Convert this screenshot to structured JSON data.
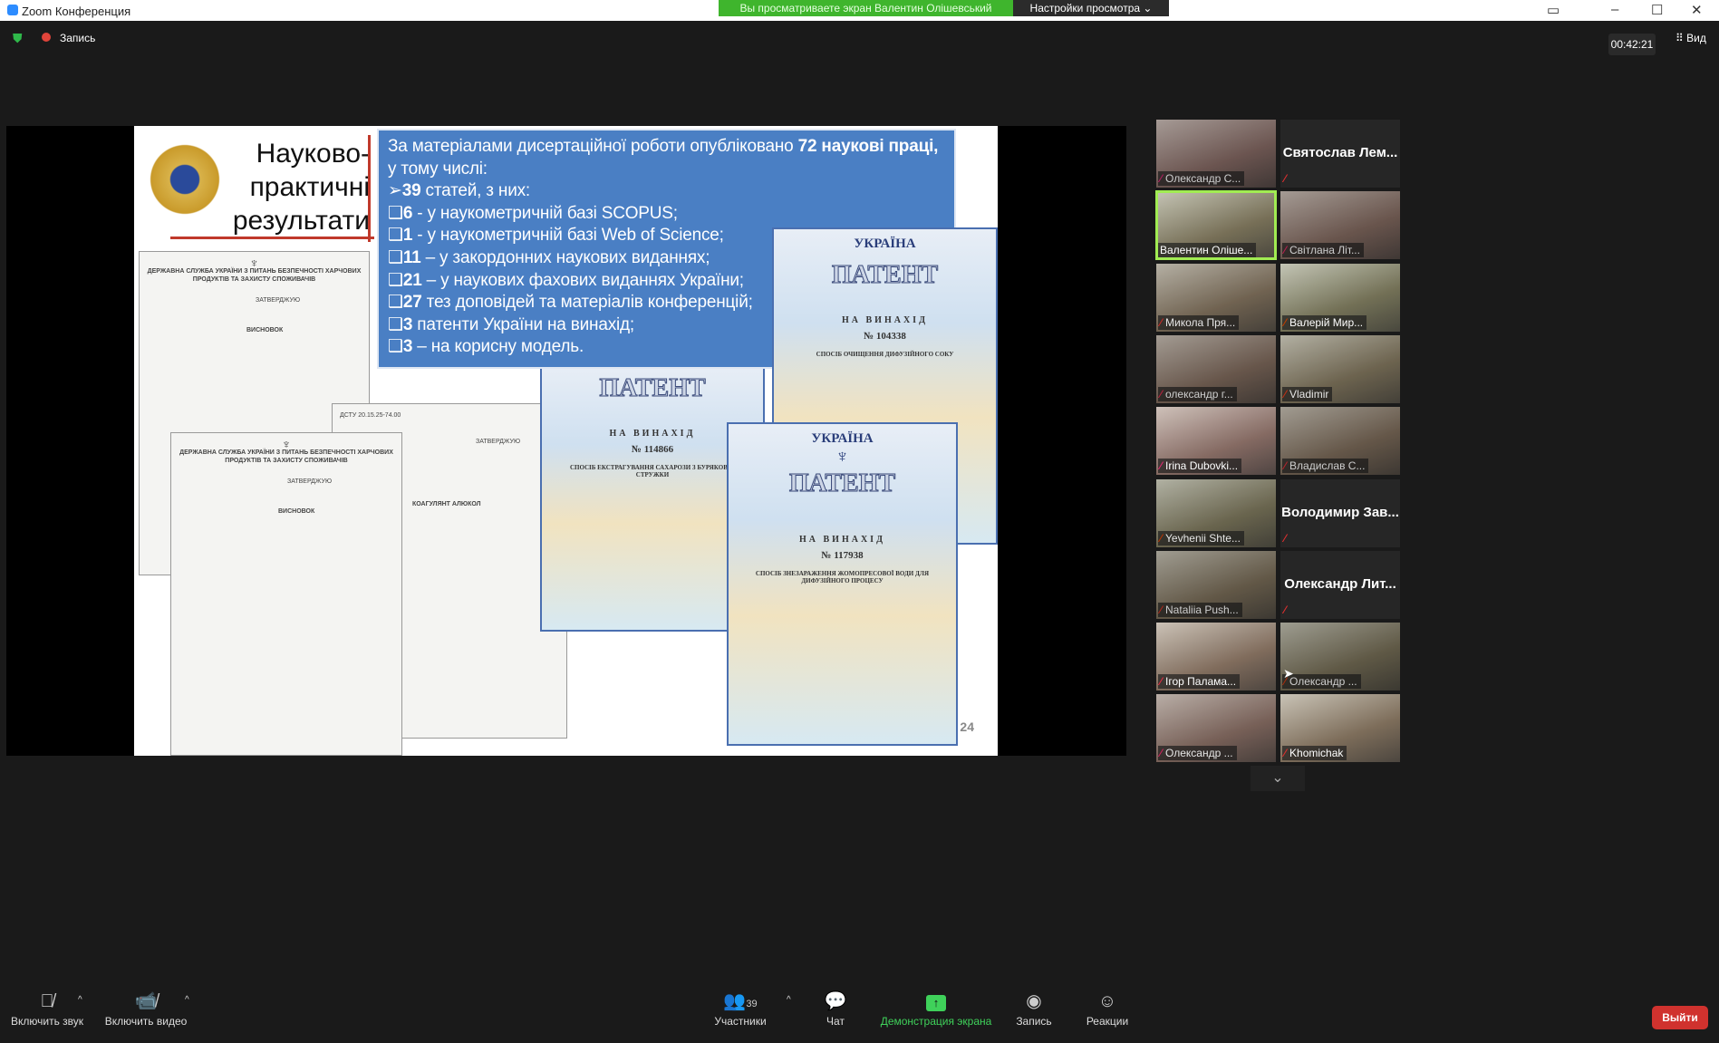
{
  "window": {
    "title": "Zoom Конференция",
    "banner": "Вы просматриваете экран Валентин Олішевський",
    "view_settings": "Настройки просмотра ⌄"
  },
  "topbar": {
    "record": "Запись",
    "timer": "00:42:21",
    "view": "Вид"
  },
  "slide": {
    "title": "Науково-практичні результати",
    "intro": "За матеріалами дисертаційної роботи опубліковано ",
    "intro_bold": "72 наукові праці,",
    "intro2": "у тому числі:",
    "items": [
      {
        "marker": "➢",
        "num": "39",
        "text": " статей, з них:"
      },
      {
        "marker": "❑",
        "num": "6",
        "text": " - у наукометричній базі SCOPUS;"
      },
      {
        "marker": "❑",
        "num": "1",
        "text": " - у наукометричній базі Web of Science;"
      },
      {
        "marker": "❑",
        "num": "11",
        "text": " – у закордонних наукових виданнях;"
      },
      {
        "marker": "❑",
        "num": "21",
        "text": " – у наукових фахових виданнях України;"
      },
      {
        "marker": "❑",
        "num": "27",
        "text": " тез доповідей та матеріалів конференцій;"
      },
      {
        "marker": "❑",
        "num": "3",
        "text": " патенти України на винахід;"
      },
      {
        "marker": "❑",
        "num": "3",
        "text": " – на корисну модель."
      }
    ],
    "page_number": "24",
    "patents": [
      {
        "country": "УКРАЇНА",
        "label": "ПАТЕНТ",
        "type": "НА ВИНАХІД",
        "number": "№ 104338",
        "desc": "СПОСІБ ОЧИЩЕННЯ ДИФУЗІЙНОГО СОКУ"
      },
      {
        "label": "ПАТЕНТ",
        "type": "НА ВИНАХІД",
        "number": "№ 114866",
        "desc": "СПОСІБ ЕКСТРАГУВАННЯ САХАРОЗИ З БУРЯКОВОЇ СТРУЖКИ"
      },
      {
        "country": "УКРАЇНА",
        "label": "ПАТЕНТ",
        "type": "НА ВИНАХІД",
        "number": "№ 117938",
        "desc": "СПОСІБ ЗНЕЗАРАЖЕННЯ ЖОМОПРЕСОВОЇ ВОДИ ДЛЯ ДИФУЗІЙНОГО ПРОЦЕСУ"
      }
    ],
    "docs": [
      {
        "head": "ДЕРЖАВНА СЛУЖБА УКРАЇНИ З ПИТАНЬ БЕЗПЕЧНОСТІ ХАРЧОВИХ ПРОДУКТІВ ТА ЗАХИСТУ СПОЖИВАЧІВ",
        "sub": "ЗАТВЕРДЖУЮ",
        "kind": "ВИСНОВОК"
      },
      {
        "head": "ДСТУ 20.15.25-74.00",
        "sub": "ЗАТВЕРДЖУЮ",
        "kind": "КОАГУЛЯНТ АЛЮКОЛ"
      },
      {
        "head": "ДЕРЖАВНА СЛУЖБА УКРАЇНИ З ПИТАНЬ БЕЗПЕЧНОСТІ ХАРЧОВИХ ПРОДУКТІВ ТА ЗАХИСТУ СПОЖИВАЧІВ",
        "sub": "ЗАТВЕРДЖУЮ",
        "kind": "ВИСНОВОК"
      }
    ]
  },
  "participants": [
    {
      "name": "Олександр С...",
      "video": true
    },
    {
      "name": "Святослав Лем...",
      "video": false
    },
    {
      "name": "Валентин Оліше...",
      "video": true,
      "active": true,
      "unmuted": true
    },
    {
      "name": "Світлана Літ...",
      "video": true
    },
    {
      "name": "Микола Пря...",
      "video": true
    },
    {
      "name": "Валерій Мир...",
      "video": true
    },
    {
      "name": "олександр г...",
      "video": true
    },
    {
      "name": "Vladimir",
      "video": true
    },
    {
      "name": "Irina Dubovki...",
      "video": true
    },
    {
      "name": "Владислав С...",
      "video": true
    },
    {
      "name": "Yevhenii Shte...",
      "video": true
    },
    {
      "name": "Володимир Зав...",
      "video": false
    },
    {
      "name": "Nataliia Push...",
      "video": true
    },
    {
      "name": "Олександр Лит...",
      "video": false
    },
    {
      "name": "Ігор Палама...",
      "video": true
    },
    {
      "name": "Олександр ...",
      "video": true
    },
    {
      "name": "Олександр ...",
      "video": true
    },
    {
      "name": "Khomichak",
      "video": true
    }
  ],
  "toolbar": {
    "unmute": "Включить звук",
    "video": "Включить видео",
    "participants": "Участники",
    "participants_count": "39",
    "chat": "Чат",
    "share": "Демонстрация экрана",
    "record": "Запись",
    "reactions": "Реакции",
    "leave": "Выйти"
  },
  "colors": {
    "share_green": "#3fd15a",
    "leave_red": "#d0322e",
    "banner_green": "#3fb52d",
    "slide_blue": "#4a7fc4"
  }
}
